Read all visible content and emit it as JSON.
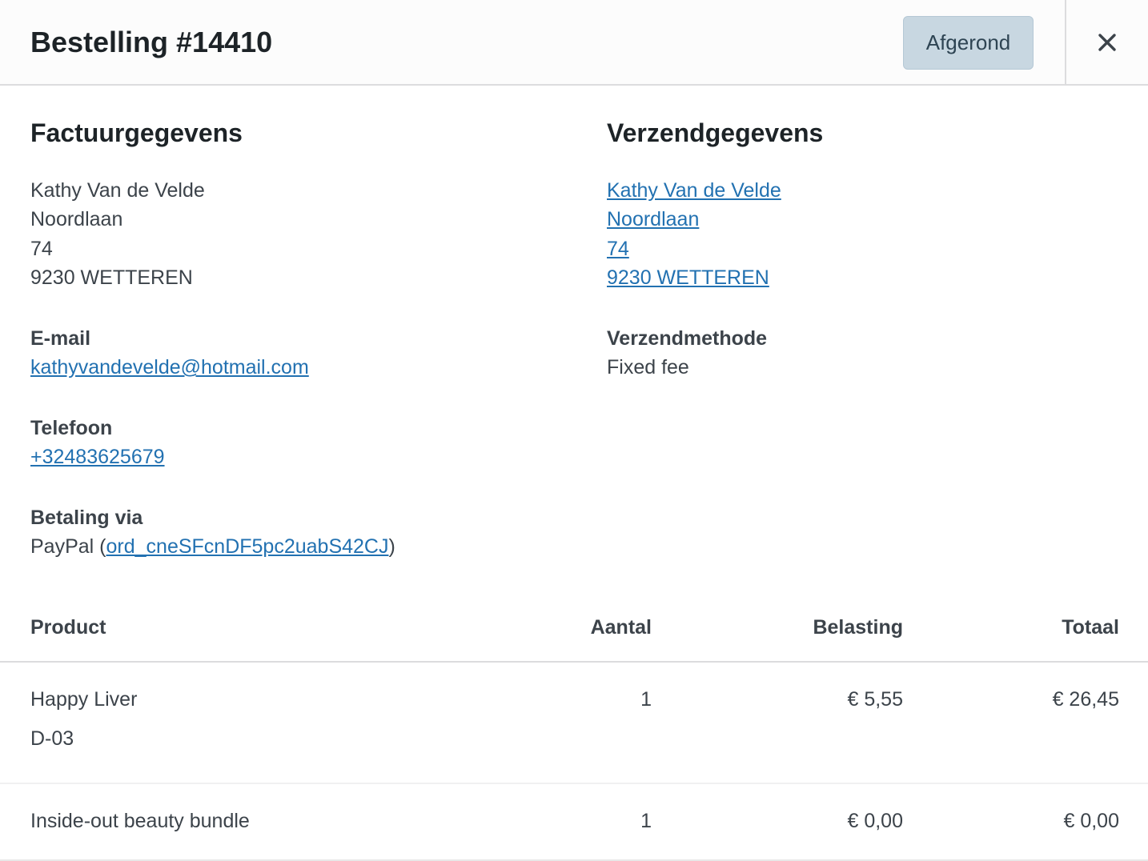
{
  "header": {
    "title": "Bestelling #14410",
    "status": "Afgerond",
    "close_icon": "close-icon"
  },
  "billing": {
    "heading": "Factuurgegevens",
    "address_lines": [
      "Kathy Van de Velde",
      "Noordlaan",
      "74",
      "9230 WETTEREN"
    ],
    "email_label": "E-mail",
    "email": "kathyvandevelde@hotmail.com",
    "phone_label": "Telefoon",
    "phone": "+32483625679",
    "payment_label": "Betaling via",
    "payment_method": "PayPal",
    "payment_open": "(",
    "payment_id": "ord_cneSFcnDF5pc2uabS42CJ",
    "payment_close": ")"
  },
  "shipping": {
    "heading": "Verzendgegevens",
    "address_lines": [
      "Kathy Van de Velde",
      "Noordlaan",
      "74",
      "9230 WETTEREN"
    ],
    "method_label": "Verzendmethode",
    "method": "Fixed fee"
  },
  "table": {
    "columns": [
      "Product",
      "Aantal",
      "Belasting",
      "Totaal"
    ],
    "rows": [
      {
        "product": "Happy Liver",
        "sku": "D-03",
        "qty": "1",
        "tax": "€ 5,55",
        "total": "€ 26,45"
      },
      {
        "product": "Inside-out beauty bundle",
        "sku": "",
        "qty": "1",
        "tax": "€ 0,00",
        "total": "€ 0,00"
      }
    ]
  },
  "colors": {
    "link": "#2271b1",
    "status_badge_bg": "#c8d7e1",
    "status_badge_text": "#2e4453",
    "heading": "#1d2327",
    "text": "#3c434a"
  }
}
